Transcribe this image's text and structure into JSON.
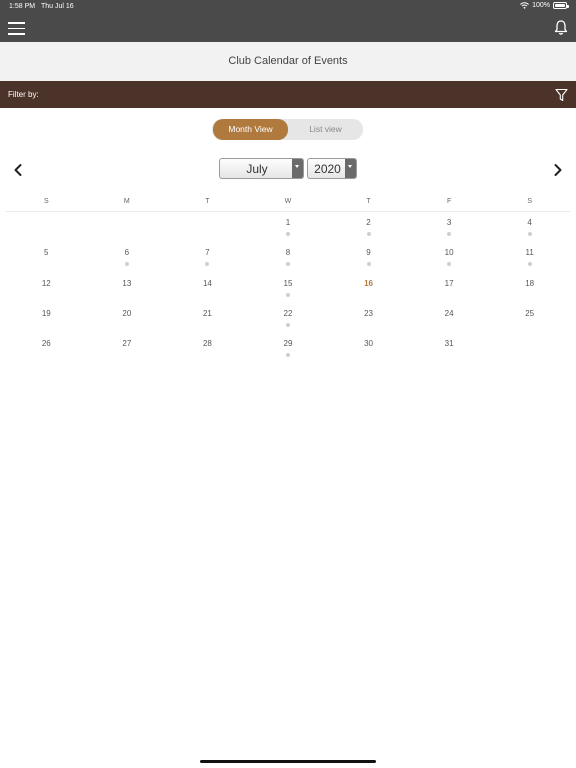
{
  "status": {
    "time": "1:58 PM",
    "date": "Thu Jul 16",
    "battery": "100%"
  },
  "header": {
    "title": "Club Calendar of Events"
  },
  "filter": {
    "label": "Filter by:"
  },
  "view_toggle": {
    "active": "Month View",
    "inactive": "List view"
  },
  "selector": {
    "month": "July",
    "year": "2020"
  },
  "weekdays": [
    "S",
    "M",
    "T",
    "W",
    "T",
    "F",
    "S"
  ],
  "weeks": [
    [
      {
        "day": ""
      },
      {
        "day": ""
      },
      {
        "day": ""
      },
      {
        "day": "1",
        "dot": true
      },
      {
        "day": "2",
        "dot": true
      },
      {
        "day": "3",
        "dot": true
      },
      {
        "day": "4",
        "dot": true
      }
    ],
    [
      {
        "day": "5"
      },
      {
        "day": "6",
        "dot": true
      },
      {
        "day": "7",
        "dot": true
      },
      {
        "day": "8",
        "dot": true
      },
      {
        "day": "9",
        "dot": true
      },
      {
        "day": "10",
        "dot": true
      },
      {
        "day": "11",
        "dot": true
      }
    ],
    [
      {
        "day": "12"
      },
      {
        "day": "13"
      },
      {
        "day": "14"
      },
      {
        "day": "15",
        "dot": true
      },
      {
        "day": "16",
        "today": true
      },
      {
        "day": "17"
      },
      {
        "day": "18"
      }
    ],
    [
      {
        "day": "19"
      },
      {
        "day": "20"
      },
      {
        "day": "21"
      },
      {
        "day": "22",
        "dot": true
      },
      {
        "day": "23"
      },
      {
        "day": "24"
      },
      {
        "day": "25"
      }
    ],
    [
      {
        "day": "26"
      },
      {
        "day": "27"
      },
      {
        "day": "28"
      },
      {
        "day": "29",
        "dot": true
      },
      {
        "day": "30"
      },
      {
        "day": "31"
      },
      {
        "day": ""
      }
    ]
  ],
  "colors": {
    "nav": "#4a4a4a",
    "filter_bar": "#4b3329",
    "accent": "#b07a3f"
  },
  "icons": {
    "menu": "hamburger-icon",
    "bell": "bell-icon",
    "filter": "funnel-icon",
    "prev": "chevron-left-icon",
    "next": "chevron-right-icon"
  }
}
